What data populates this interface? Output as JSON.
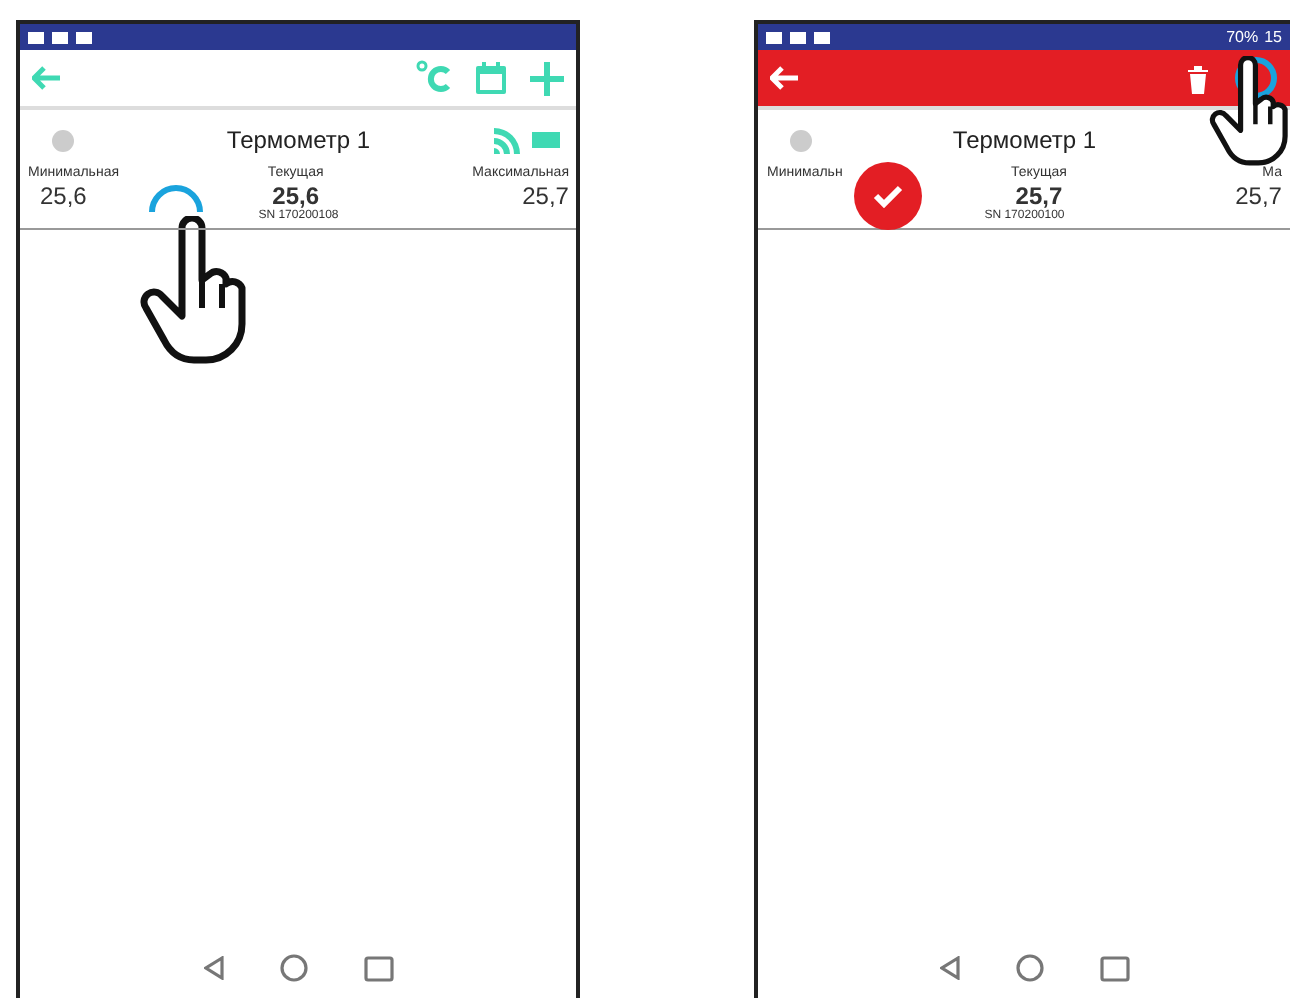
{
  "phones": [
    {
      "selection_mode": false,
      "card": {
        "title": "Термометр 1",
        "selected": false,
        "signal": true,
        "columns": [
          {
            "label": "Минимальная",
            "value": "25,6"
          },
          {
            "label": "Текущая",
            "value": "25,6"
          },
          {
            "label": "Максимальная",
            "value": "25,7"
          }
        ],
        "serial": "SN 170200108"
      },
      "gesture": {
        "kind": "card"
      }
    },
    {
      "status_bar": {
        "battery": "70%",
        "time": "15"
      },
      "selection_mode": true,
      "card": {
        "title": "Термометр 1",
        "selected": true,
        "columns": [
          {
            "label": "Минимальн"
          },
          {
            "label": "Текущая",
            "value": "25,7"
          },
          {
            "label": "Ма",
            "value": "25,7"
          }
        ],
        "serial": "SN 170200100"
      },
      "gesture": {
        "kind": "toolbar"
      }
    }
  ]
}
